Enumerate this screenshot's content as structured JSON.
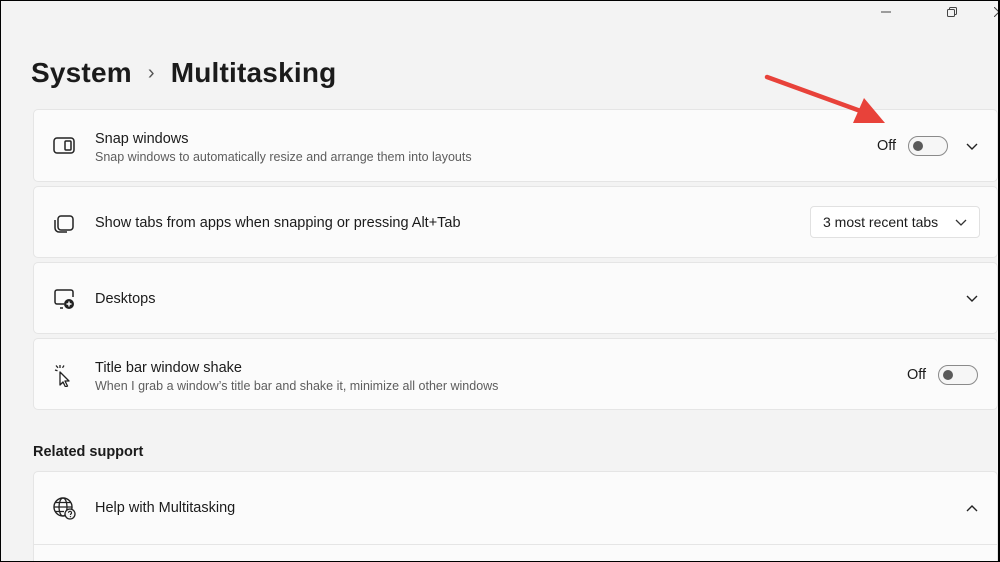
{
  "window_controls": {
    "minimize_icon": "minimize-icon",
    "maximize_icon": "restore-icon",
    "close_icon": "close-icon"
  },
  "breadcrumb": {
    "parent": "System",
    "separator": "›",
    "current": "Multitasking"
  },
  "settings": {
    "snap_windows": {
      "title": "Snap windows",
      "description": "Snap windows to automatically resize and arrange them into layouts",
      "state_label": "Off",
      "enabled": false,
      "icon": "snap-layout-icon"
    },
    "show_tabs": {
      "title": "Show tabs from apps when snapping or pressing Alt+Tab",
      "selected_option": "3 most recent tabs",
      "icon": "tabs-icon"
    },
    "desktops": {
      "title": "Desktops",
      "icon": "desktop-add-icon"
    },
    "title_bar_shake": {
      "title": "Title bar window shake",
      "description": "When I grab a window’s title bar and shake it, minimize all other windows",
      "state_label": "Off",
      "enabled": false,
      "icon": "cursor-shake-icon"
    }
  },
  "related_support": {
    "heading": "Related support",
    "help_item": {
      "title": "Help with Multitasking",
      "icon": "globe-help-icon",
      "expanded": true
    }
  },
  "colors": {
    "background": "#f3f3f3",
    "card": "#fbfbfb",
    "annotation_arrow": "#e8423a"
  }
}
